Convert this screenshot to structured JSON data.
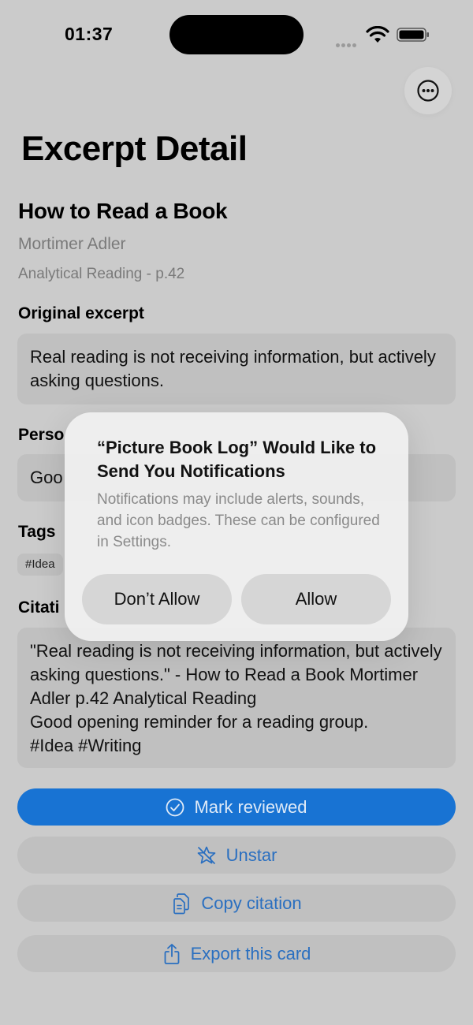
{
  "status_bar": {
    "time": "01:37"
  },
  "page_title": "Excerpt Detail",
  "book": {
    "title": "How to Read a Book",
    "author": "Mortimer Adler",
    "chapter": "Analytical Reading - p.42"
  },
  "sections": {
    "original_label": "Original excerpt",
    "original_text": "Real reading is not receiving information, but actively asking questions.",
    "personal_label": "Perso",
    "personal_text": "Goo",
    "tags_label": "Tags",
    "tag_first": "#Idea",
    "citation_label": "Citati",
    "citation_text": "\"Real reading is not receiving information, but actively asking questions.\" - How to Read a Book Mortimer Adler p.42 Analytical Reading\nGood opening reminder for a reading group.\n#Idea #Writing"
  },
  "actions": {
    "mark_reviewed": "Mark reviewed",
    "unstar": "Unstar",
    "copy_citation": "Copy citation",
    "export_card": "Export this card"
  },
  "alert": {
    "title": "“Picture Book Log” Would Like to Send You Notifications",
    "message": "Notifications may include alerts, sounds, and icon badges. These can be configured in Settings.",
    "dont_allow": "Don’t Allow",
    "allow": "Allow"
  },
  "colors": {
    "accent": "#1873d3",
    "link": "#2a6fc0",
    "background": "#cbcbcb"
  },
  "icons": [
    "ellipsis-circle-icon",
    "checkmark-circle-icon",
    "star-slash-icon",
    "copy-document-icon",
    "share-icon",
    "wifi-icon",
    "battery-icon"
  ]
}
